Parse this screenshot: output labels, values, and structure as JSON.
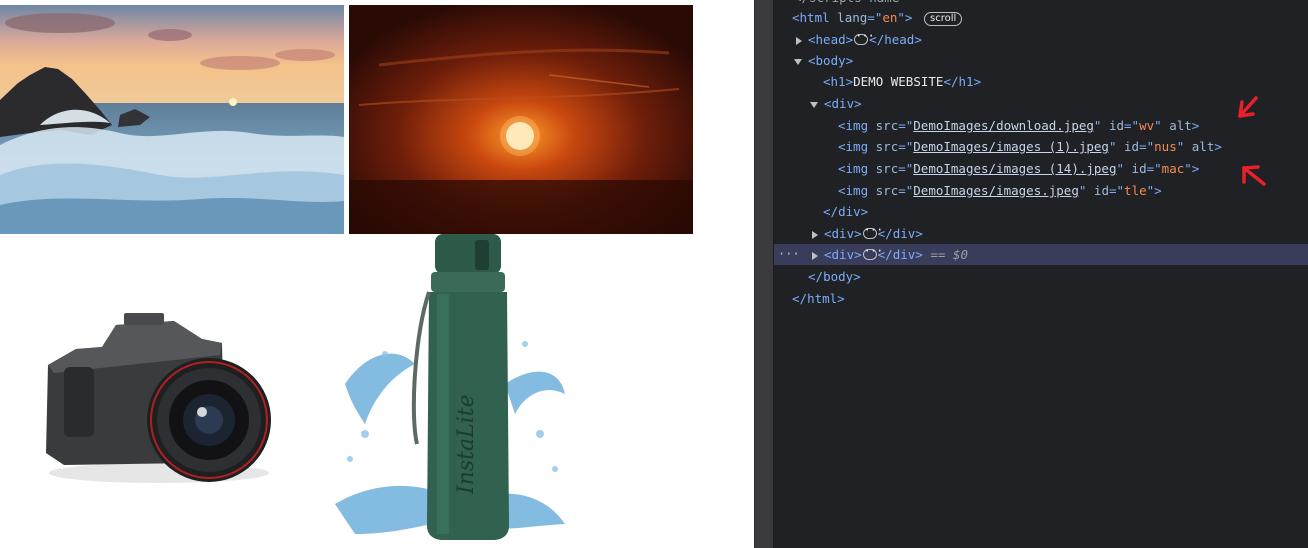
{
  "browser": {
    "images": [
      {
        "name": "waves-image",
        "alt": ""
      },
      {
        "name": "sunset-image",
        "alt": ""
      },
      {
        "name": "camera-image",
        "alt": ""
      },
      {
        "name": "bottle-image",
        "alt": "",
        "logo_text": "InstaLite"
      }
    ]
  },
  "devtools": {
    "top_partial": "</scripts name=",
    "html_open": {
      "tag": "html",
      "attr": "lang",
      "val": "en",
      "pill": "scroll"
    },
    "head": "head",
    "body": "body",
    "h1": {
      "tag": "h1",
      "text": "DEMO WEBSITE"
    },
    "div": "div",
    "imgs": [
      {
        "src": "DemoImages/download.jpeg",
        "id": "wv",
        "alt": "alt"
      },
      {
        "src": "DemoImages/images (1).jpeg",
        "id": "nus",
        "alt": "alt"
      },
      {
        "src": "DemoImages/images (14).jpeg",
        "id": "mac",
        "alt": ""
      },
      {
        "src": "DemoImages/images.jpeg",
        "id": "tle",
        "alt": ""
      }
    ],
    "selected_marker": "== $0",
    "gutter": "···"
  }
}
